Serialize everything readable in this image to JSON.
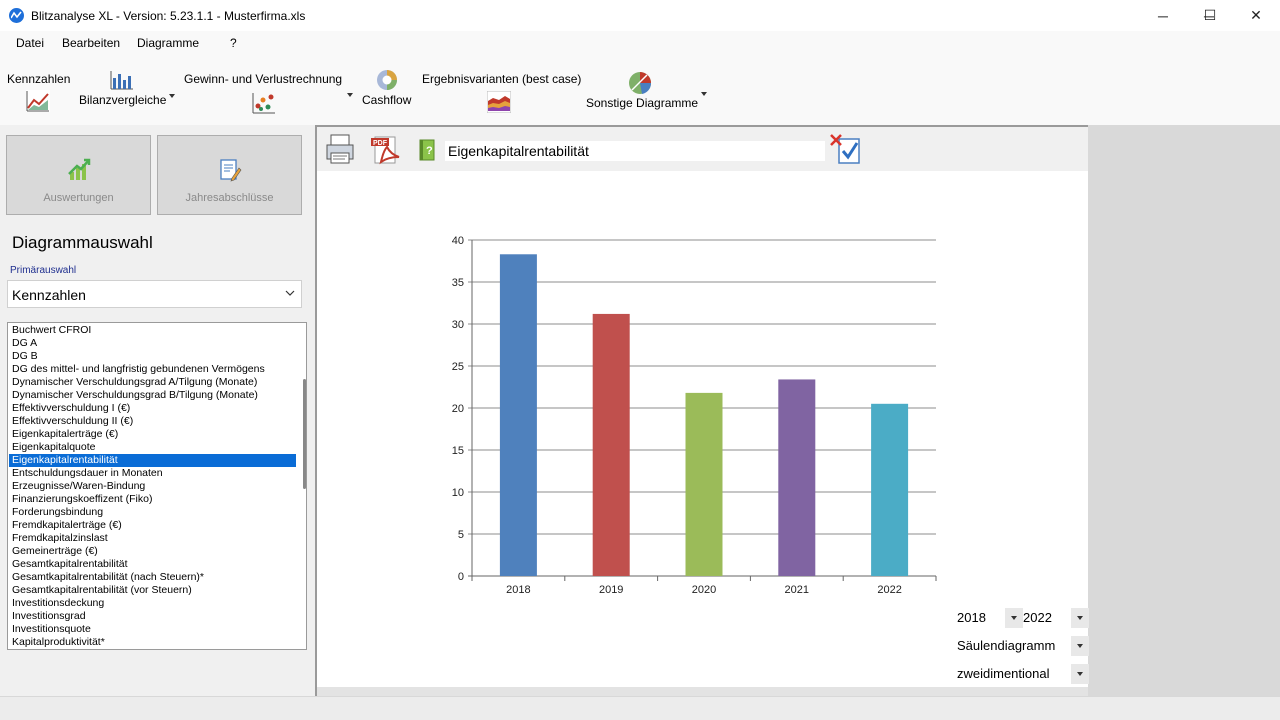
{
  "window": {
    "title": "Blitzanalyse XL - Version: 5.23.1.1 - Musterfirma.xls",
    "minimize_glyph": "─",
    "maximize_glyph": "☐",
    "close_glyph": "✕"
  },
  "menu": [
    "Datei",
    "Bearbeiten",
    "Diagramme",
    "?"
  ],
  "ribbon": {
    "kennzahlen": "Kennzahlen",
    "bilanzvergleiche": "Bilanzvergleiche",
    "guv": "Gewinn- und Verlustrechnung",
    "cashflow": "Cashflow",
    "ergebnisvarianten": "Ergebnisvarianten (best case)",
    "sonstige": "Sonstige Diagramme"
  },
  "left": {
    "auswertungen": "Auswertungen",
    "jahresabschluesse": "Jahresabschlüsse",
    "heading": "Diagrammauswahl",
    "primary_label": "Primärauswahl",
    "primary_value": "Kennzahlen",
    "selected_index": 10,
    "items": [
      "Buchwert CFROI",
      "DG A",
      "DG B",
      "DG des mittel- und langfristig gebundenen Vermögens",
      "Dynamischer Verschuldungsgrad A/Tilgung (Monate)",
      "Dynamischer Verschuldungsgrad B/Tilgung (Monate)",
      "Effektivverschuldung I (€)",
      "Effektivverschuldung II (€)",
      "Eigenkapitalerträge (€)",
      "Eigenkapitalquote",
      "Eigenkapitalrentabilität",
      "Entschuldungsdauer in Monaten",
      "Erzeugnisse/Waren-Bindung",
      "Finanzierungskoeffizent (Fiko)",
      "Forderungsbindung",
      "Fremdkapitalerträge (€)",
      "Fremdkapitalzinslast",
      "Gemeinerträge (€)",
      "Gesamtkapitalrentabilität",
      "Gesamtkapitalrentabilität (nach Steuern)*",
      "Gesamtkapitalrentabilität (vor Steuern)",
      "Investitionsdeckung",
      "Investitionsgrad",
      "Investitionsquote",
      "Kapitalproduktivität*"
    ]
  },
  "chart_toolbar": {
    "title_field": "Eigenkapitalrentabilität",
    "pdf_label": "PDF"
  },
  "controls": {
    "year_from": "2018",
    "year_to": "2022",
    "chart_type": "Säulendiagramm",
    "dimension": "zweidimentional"
  },
  "chart_data": {
    "type": "bar",
    "categories": [
      "2018",
      "2019",
      "2020",
      "2021",
      "2022"
    ],
    "values": [
      38.3,
      31.2,
      21.8,
      23.4,
      20.5
    ],
    "colors": [
      "#4f81bd",
      "#c0504d",
      "#9bbb59",
      "#8064a2",
      "#4bacc6"
    ],
    "ylim": [
      0,
      40
    ],
    "yticks": [
      0,
      5,
      10,
      15,
      20,
      25,
      30,
      35,
      40
    ],
    "grid": true
  }
}
